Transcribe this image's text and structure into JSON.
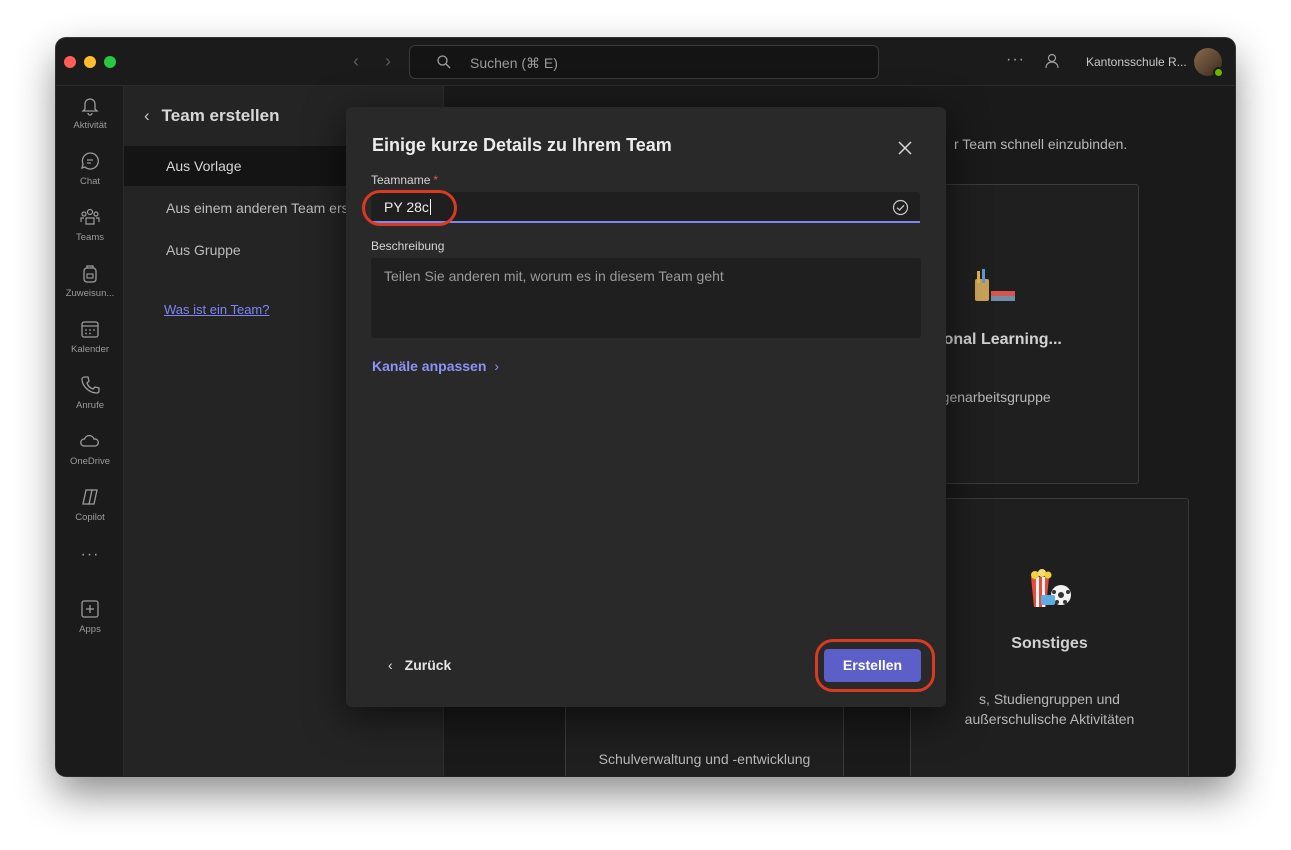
{
  "titlebar": {
    "search_placeholder": "Suchen (⌘ E)",
    "more_label": "···",
    "org_name": "Kantonsschule R..."
  },
  "rail": {
    "items": [
      {
        "label": "Aktivität",
        "icon": "bell-icon"
      },
      {
        "label": "Chat",
        "icon": "chat-icon"
      },
      {
        "label": "Teams",
        "icon": "teams-icon"
      },
      {
        "label": "Zuweisun...",
        "icon": "backpack-icon"
      },
      {
        "label": "Kalender",
        "icon": "calendar-icon"
      },
      {
        "label": "Anrufe",
        "icon": "phone-icon"
      },
      {
        "label": "OneDrive",
        "icon": "cloud-icon"
      },
      {
        "label": "Copilot",
        "icon": "copilot-icon"
      },
      {
        "label": "···",
        "icon": "more-icon"
      },
      {
        "label": "Apps",
        "icon": "apps-icon"
      }
    ]
  },
  "panel": {
    "title": "Team erstellen",
    "items": [
      {
        "label": "Aus Vorlage",
        "selected": true
      },
      {
        "label": "Aus einem anderen Team erstellen",
        "selected": false
      },
      {
        "label": "Aus Gruppe",
        "selected": false
      }
    ],
    "help_link": "Was ist ein Team?"
  },
  "main": {
    "description_fragment": "r Team schnell einzubinden.",
    "cards": [
      {
        "title": "fessional Learning...",
        "subtitle": "agogenarbeitsgruppe",
        "icon": "books-pencils-icon"
      },
      {
        "title": "Sonstiges",
        "subtitle": "s, Studiengruppen und außerschulische Aktivitäten",
        "icon": "popcorn-ball-icon"
      },
      {
        "title": "",
        "subtitle": "Schulverwaltung und -entwicklung",
        "icon": ""
      }
    ]
  },
  "modal": {
    "title": "Einige kurze Details zu Ihrem Team",
    "team_name_label": "Teamname",
    "required_mark": "*",
    "team_name_value": "PY 28c",
    "description_label": "Beschreibung",
    "description_placeholder": "Teilen Sie anderen mit, worum es in diesem Team geht",
    "channels_link": "Kanäle anpassen",
    "back_label": "Zurück",
    "create_label": "Erstellen"
  },
  "colors": {
    "accent": "#5b5fc7",
    "link": "#7f85f5",
    "highlight_ring": "#d93a22"
  }
}
